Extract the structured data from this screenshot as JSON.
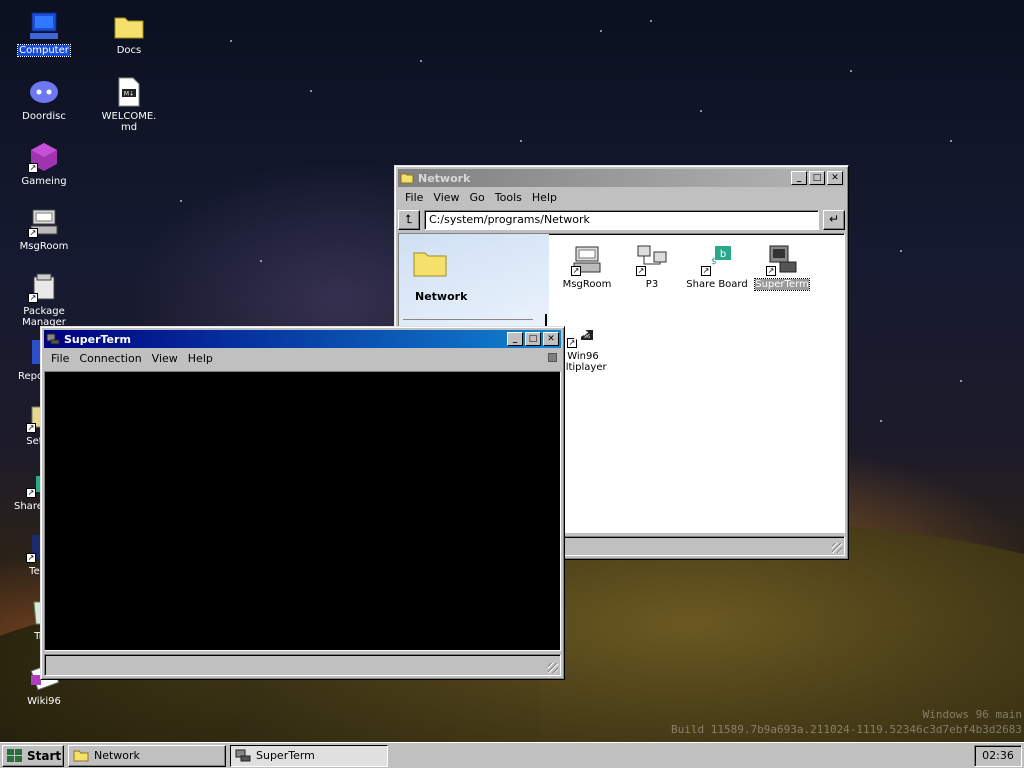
{
  "desktop": {
    "icons": [
      {
        "label": "Computer",
        "icon": "computer-icon"
      },
      {
        "label": "Docs",
        "icon": "folder-icon"
      },
      {
        "label": "Doordisc",
        "icon": "discord-icon"
      },
      {
        "label": "WELCOME.md",
        "icon": "markdown-file-icon"
      },
      {
        "label": "Gameing",
        "icon": "cube-icon"
      },
      {
        "label": "MsgRoom",
        "icon": "msgroom-icon"
      },
      {
        "label": "Package Manager",
        "icon": "package-icon"
      },
      {
        "label": "Repo",
        "icon": "repo-icon"
      },
      {
        "label": "Set",
        "icon": "settings-icon"
      },
      {
        "label": "Share",
        "icon": "share-icon"
      },
      {
        "label": "Ter",
        "icon": "terminal-icon"
      },
      {
        "label": "Tr",
        "icon": "trash-icon"
      },
      {
        "label": "Wiki96",
        "icon": "wiki-icon"
      }
    ],
    "build_text": [
      "Windows 96 main",
      "Build 11589.7b9a693a.211024-1119.52346c3d7ebf4b3d2683"
    ]
  },
  "network_window": {
    "title": "Network",
    "menu": [
      "File",
      "View",
      "Go",
      "Tools",
      "Help"
    ],
    "address": "C:/system/programs/Network",
    "side_title": "Network",
    "items": [
      {
        "label": "MsgRoom",
        "icon": "msgroom-icon"
      },
      {
        "label": "P3",
        "icon": "p3-icon"
      },
      {
        "label": "Share Board",
        "icon": "share-board-icon"
      },
      {
        "label": "SuperTerm",
        "icon": "superterm-icon"
      },
      {
        "label": "Win96 Multiplayer",
        "icon": "multiplayer-icon"
      }
    ],
    "partial_label": "Win96\nultiplayer"
  },
  "superterm_window": {
    "title": "SuperTerm",
    "menu": [
      "File",
      "Connection",
      "View",
      "Help"
    ]
  },
  "taskbar": {
    "start_label": "Start",
    "tasks": [
      {
        "label": "Network",
        "icon": "folder-icon"
      },
      {
        "label": "SuperTerm",
        "icon": "superterm-icon"
      }
    ],
    "clock": "02:36"
  }
}
